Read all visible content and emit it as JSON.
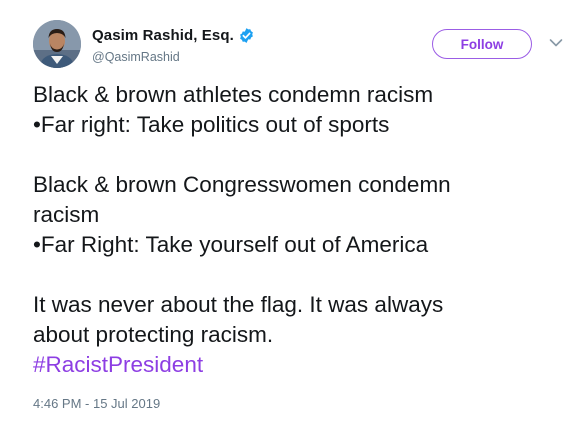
{
  "author": {
    "display_name": "Qasim Rashid, Esq.",
    "handle": "@QasimRashid",
    "verified": true,
    "avatar_icon": "profile-photo"
  },
  "actions": {
    "follow_label": "Follow",
    "menu_icon": "chevron-down-icon"
  },
  "tweet": {
    "lines": [
      "Black & brown athletes condemn racism",
      "•Far right: Take politics out of sports",
      "",
      "Black & brown Congresswomen condemn",
      "racism",
      "•Far Right: Take yourself out of America",
      "",
      "It was never about the flag. It was always",
      "about protecting racism."
    ],
    "hashtag": "#RacistPresident",
    "timestamp": "4:46 PM - 15 Jul 2019"
  },
  "colors": {
    "accent": "#8d3ee3",
    "verified_badge": "#1da1f2",
    "text": "#14171a",
    "muted": "#657786"
  }
}
